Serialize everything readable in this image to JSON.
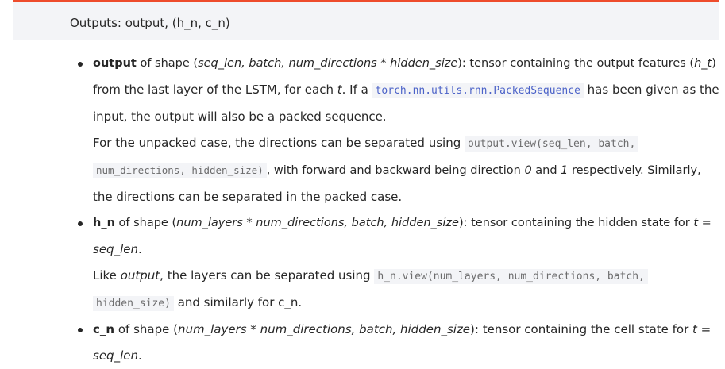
{
  "header": {
    "text": "Outputs: output, (h_n, c_n)"
  },
  "output_item": {
    "name": "output",
    "of_shape": " of shape (",
    "shape": "seq_len, batch, num_directions * hidden_size",
    "desc_start": "): tensor containing the output features (",
    "ht": "h_t",
    "desc_mid": ")",
    "line2_start": "from the last layer of the LSTM, for each ",
    "t": "t",
    "line2_mid": ". If a ",
    "packed_seq_code": "torch.nn.utils.rnn.PackedSequence",
    "line2_end": " has been given as the",
    "line3": "input, the output will also be a packed sequence.",
    "line4_start": "For the unpacked case, the directions can be separated using ",
    "view_code_1": "output.view(seq_len, batch,",
    "view_code_2": "num_directions, hidden_size)",
    "line5_mid": ", with forward and backward being direction ",
    "dir0": "0",
    "and_text": " and ",
    "dir1": "1",
    "line5_end": " respectively. Similarly,",
    "line6": "the directions can be separated in the packed case."
  },
  "hn_item": {
    "name": "h_n",
    "of_shape": " of shape (",
    "shape": "num_layers * num_directions, batch, hidden_size",
    "desc": "): tensor containing the hidden state for ",
    "t_eq": "t =",
    "seq_len": "seq_len",
    "period": ".",
    "like": "Like ",
    "output_word": "output",
    "like_rest": ", the layers can be separated using ",
    "view_code_1": "h_n.view(num_layers, num_directions, batch,",
    "view_code_2": "hidden_size)",
    "end": " and similarly for c_n."
  },
  "cn_item": {
    "name": "c_n",
    "of_shape": " of shape (",
    "shape": "num_layers * num_directions, batch, hidden_size",
    "desc": "): tensor containing the cell state for ",
    "t_eq": "t =",
    "seq_len": "seq_len",
    "period": "."
  }
}
